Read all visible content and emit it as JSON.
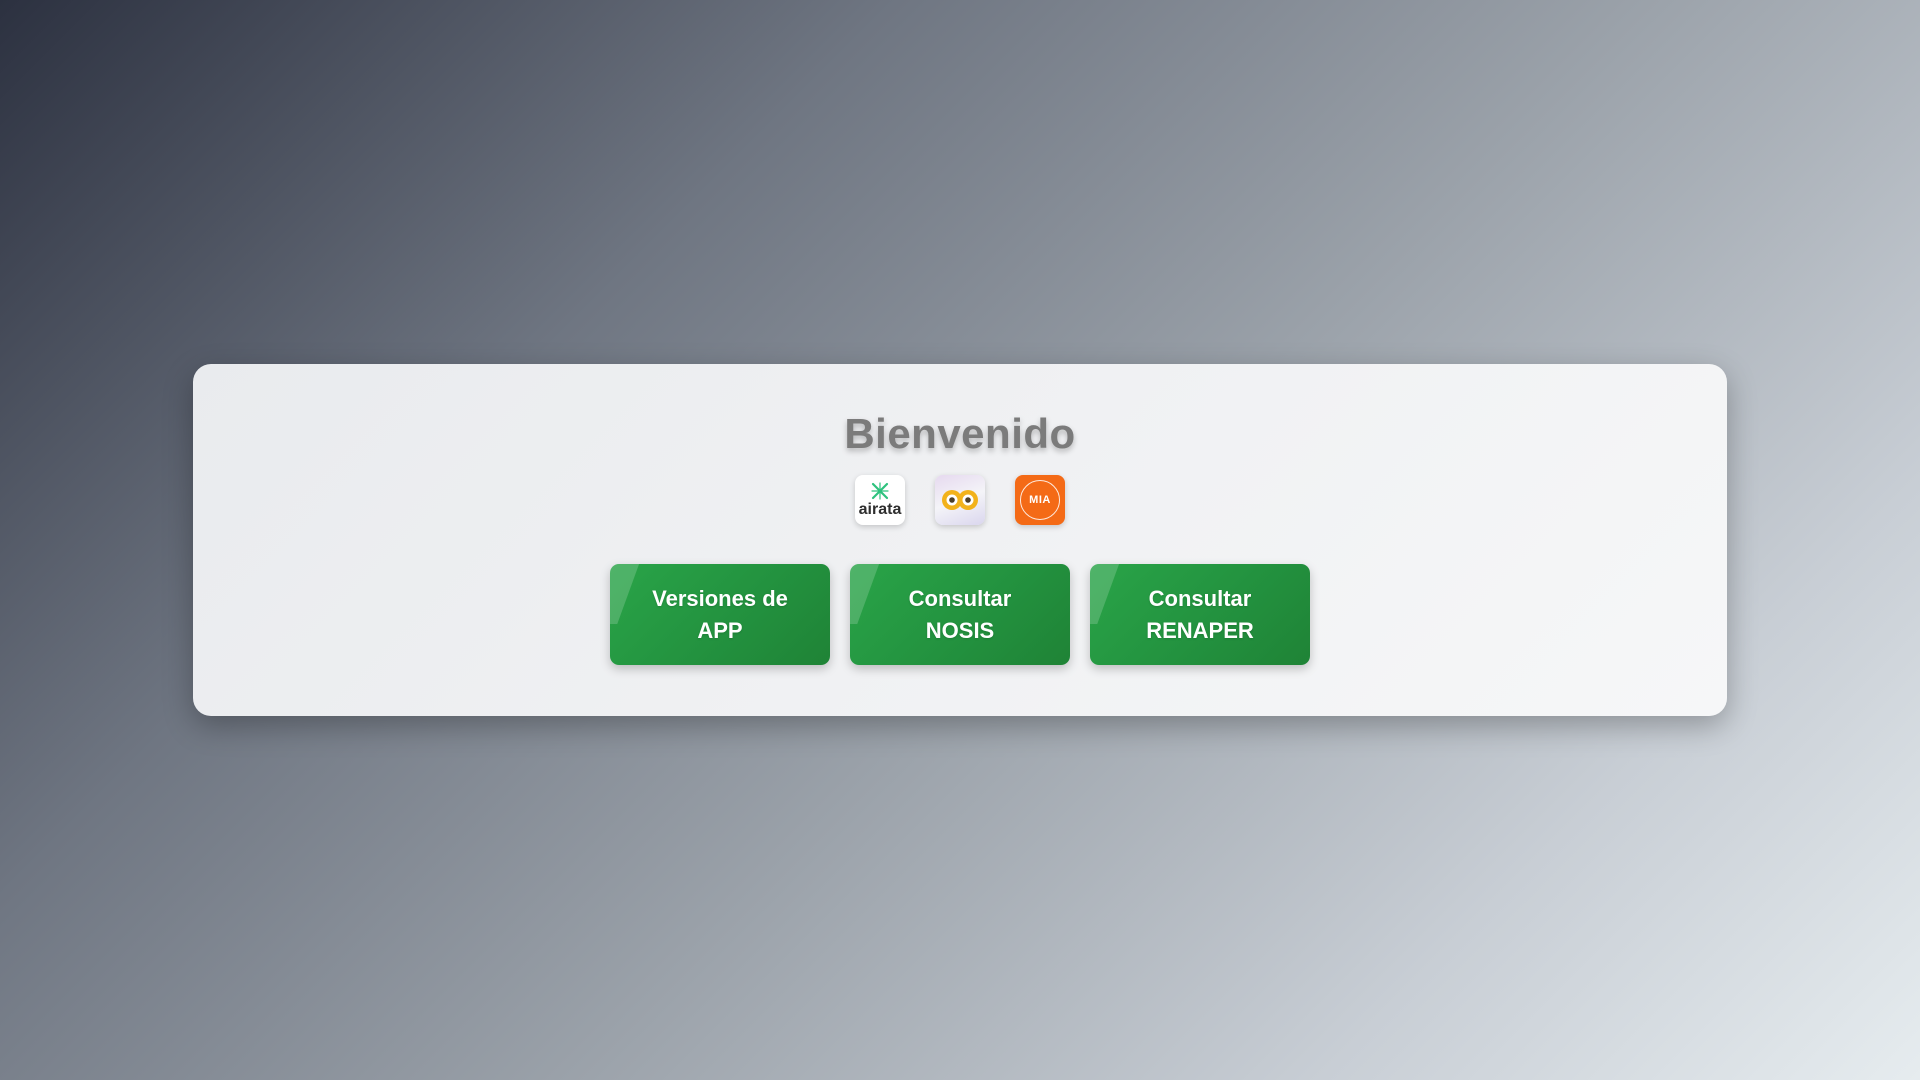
{
  "welcome": {
    "title": "Bienvenido"
  },
  "logos": [
    {
      "name": "airata",
      "text": "airata"
    },
    {
      "name": "nosis",
      "text": ""
    },
    {
      "name": "mia",
      "text": "MIA"
    }
  ],
  "buttons": {
    "versiones_app": "Versiones de\nAPP",
    "consultar_nosis": "Consultar\nNOSIS",
    "consultar_renaper": "Consultar\nRENAPER"
  },
  "colors": {
    "button_green": "#26994a",
    "mia_orange": "#f46a16",
    "airata_green": "#2ec27e",
    "nosis_yellow": "#f2b21b"
  }
}
